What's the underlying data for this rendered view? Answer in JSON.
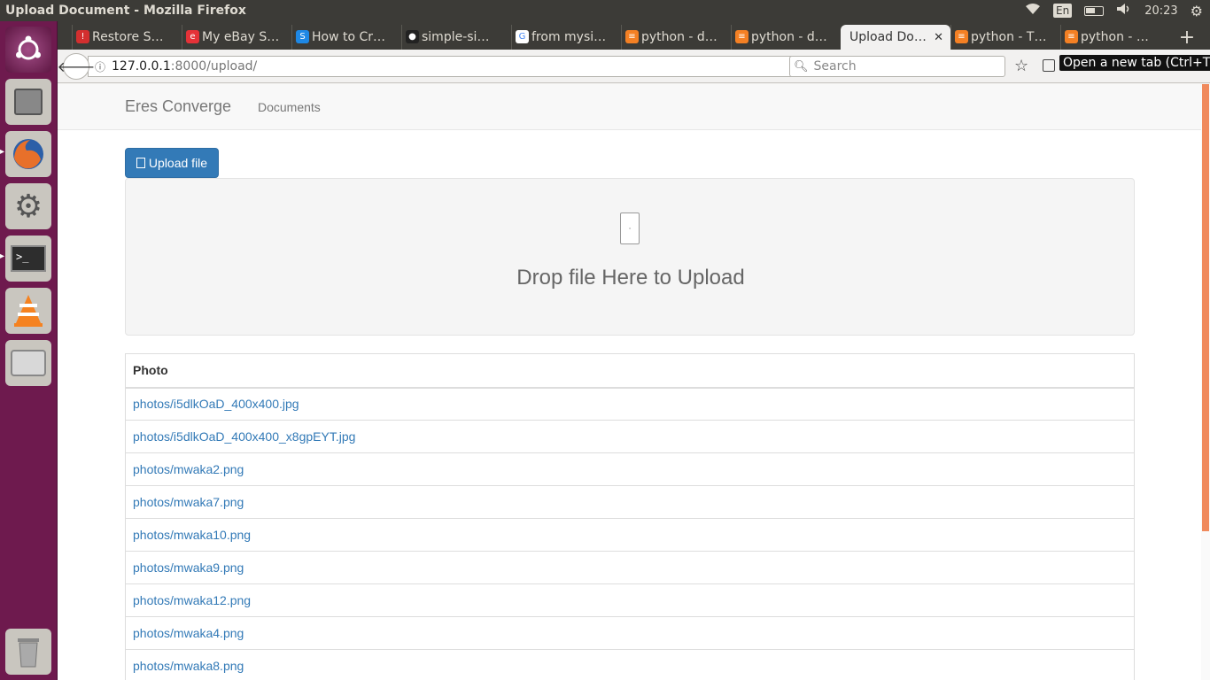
{
  "window": {
    "title": "Upload Document - Mozilla Firefox"
  },
  "tray": {
    "language": "En",
    "time": "20:23"
  },
  "tabs": [
    {
      "label": "Restore S…",
      "favicon_color": "#d32f2f",
      "favicon_glyph": "!"
    },
    {
      "label": "My eBay S…",
      "favicon_color": "#e53238",
      "favicon_glyph": "e"
    },
    {
      "label": "How to Cr…",
      "favicon_color": "#1e88e5",
      "favicon_glyph": "S"
    },
    {
      "label": "simple-si…",
      "favicon_color": "#222222",
      "favicon_glyph": "●"
    },
    {
      "label": "from mysi…",
      "favicon_color": "#ffffff",
      "favicon_glyph": "G"
    },
    {
      "label": "python - d…",
      "favicon_color": "#f48024",
      "favicon_glyph": "≡"
    },
    {
      "label": "python - d…",
      "favicon_color": "#f48024",
      "favicon_glyph": "≡"
    },
    {
      "label": "Upload Do…",
      "favicon_color": "",
      "favicon_glyph": ""
    },
    {
      "label": "python - T…",
      "favicon_color": "#f48024",
      "favicon_glyph": "≡"
    },
    {
      "label": "python - …",
      "favicon_color": "#f48024",
      "favicon_glyph": "≡"
    }
  ],
  "selected_tab_index": 7,
  "urlbar": {
    "host": "127.0.0.1",
    "path": ":8000/upload/"
  },
  "searchbar": {
    "placeholder": "Search"
  },
  "tooltip": "Open a new tab (Ctrl+T)",
  "site": {
    "brand": "Eres Converge",
    "nav_documents": "Documents",
    "upload_button": "Upload file",
    "dropzone_text": "Drop file Here to Upload",
    "table_header": "Photo",
    "photos": [
      "photos/i5dlkOaD_400x400.jpg",
      "photos/i5dlkOaD_400x400_x8gpEYT.jpg",
      "photos/mwaka2.png",
      "photos/mwaka7.png",
      "photos/mwaka10.png",
      "photos/mwaka9.png",
      "photos/mwaka12.png",
      "photos/mwaka4.png",
      "photos/mwaka8.png"
    ]
  },
  "launcher_icons": [
    "ubuntu-dash-icon",
    "files-icon",
    "firefox-icon",
    "system-settings-icon",
    "terminal-icon",
    "vlc-icon",
    "disks-icon",
    "trash-icon"
  ],
  "colors": {
    "accent": "#337ab7",
    "launcher": "#6e1a4e",
    "scroll_thumb": "#f08a5d"
  }
}
